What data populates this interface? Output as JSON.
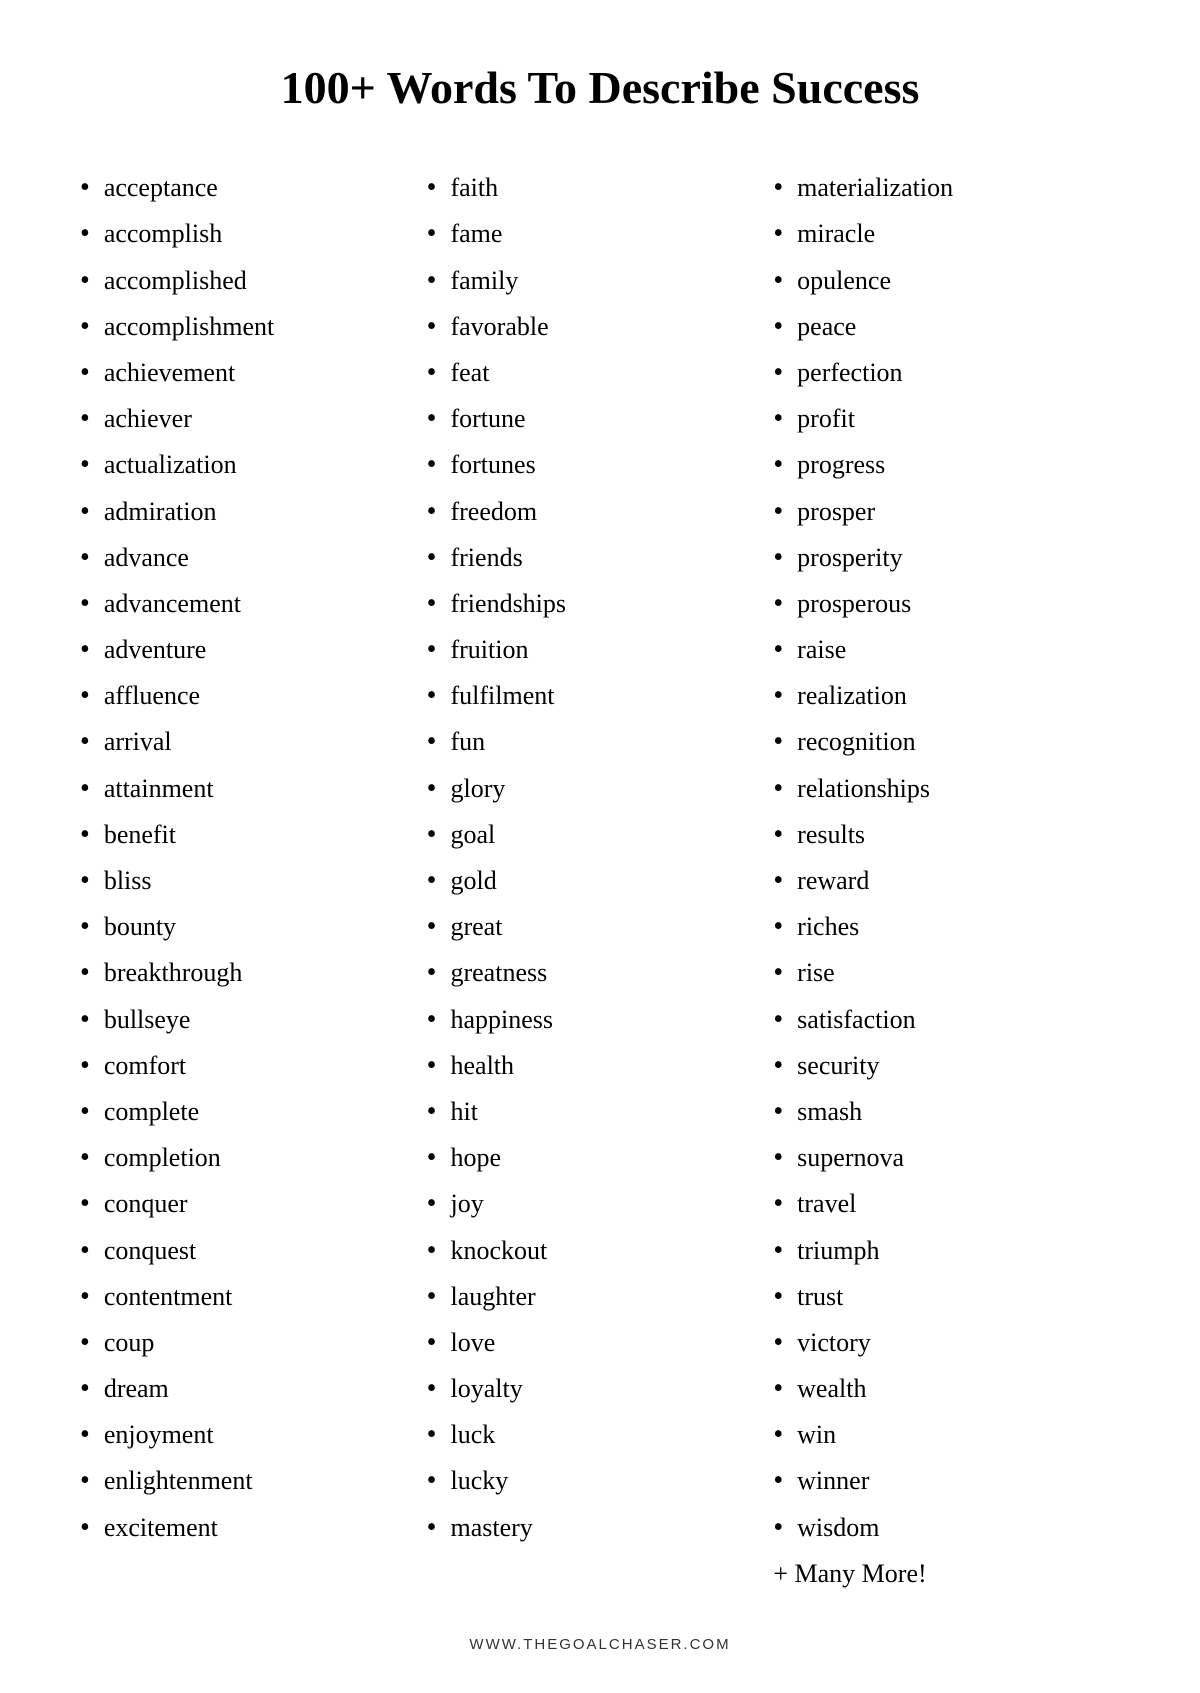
{
  "title": "100+ Words To Describe Success",
  "columns": [
    {
      "id": "col1",
      "words": [
        "acceptance",
        "accomplish",
        "accomplished",
        "accomplishment",
        "achievement",
        "achiever",
        "actualization",
        "admiration",
        "advance",
        "advancement",
        "adventure",
        "affluence",
        "arrival",
        "attainment",
        "benefit",
        "bliss",
        "bounty",
        "breakthrough",
        "bullseye",
        "comfort",
        "complete",
        "completion",
        "conquer",
        "conquest",
        "contentment",
        "coup",
        "dream",
        "enjoyment",
        "enlightenment",
        "excitement"
      ]
    },
    {
      "id": "col2",
      "words": [
        "faith",
        "fame",
        "family",
        "favorable",
        "feat",
        "fortune",
        "fortunes",
        "freedom",
        "friends",
        "friendships",
        "fruition",
        "fulfilment",
        "fun",
        "glory",
        "goal",
        "gold",
        "great",
        "greatness",
        "happiness",
        "health",
        "hit",
        "hope",
        "joy",
        "knockout",
        "laughter",
        "love",
        "loyalty",
        "luck",
        "lucky",
        "mastery"
      ]
    },
    {
      "id": "col3",
      "words": [
        "materialization",
        "miracle",
        "opulence",
        "peace",
        "perfection",
        "profit",
        "progress",
        "prosper",
        "prosperity",
        "prosperous",
        "raise",
        "realization",
        "recognition",
        "relationships",
        "results",
        "reward",
        "riches",
        "rise",
        "satisfaction",
        "security",
        "smash",
        "supernova",
        "travel",
        "triumph",
        "trust",
        "victory",
        "wealth",
        "win",
        "winner",
        "wisdom"
      ]
    }
  ],
  "many_more": "+ Many More!",
  "footer": "WWW.THEGOALCHASER.COM"
}
